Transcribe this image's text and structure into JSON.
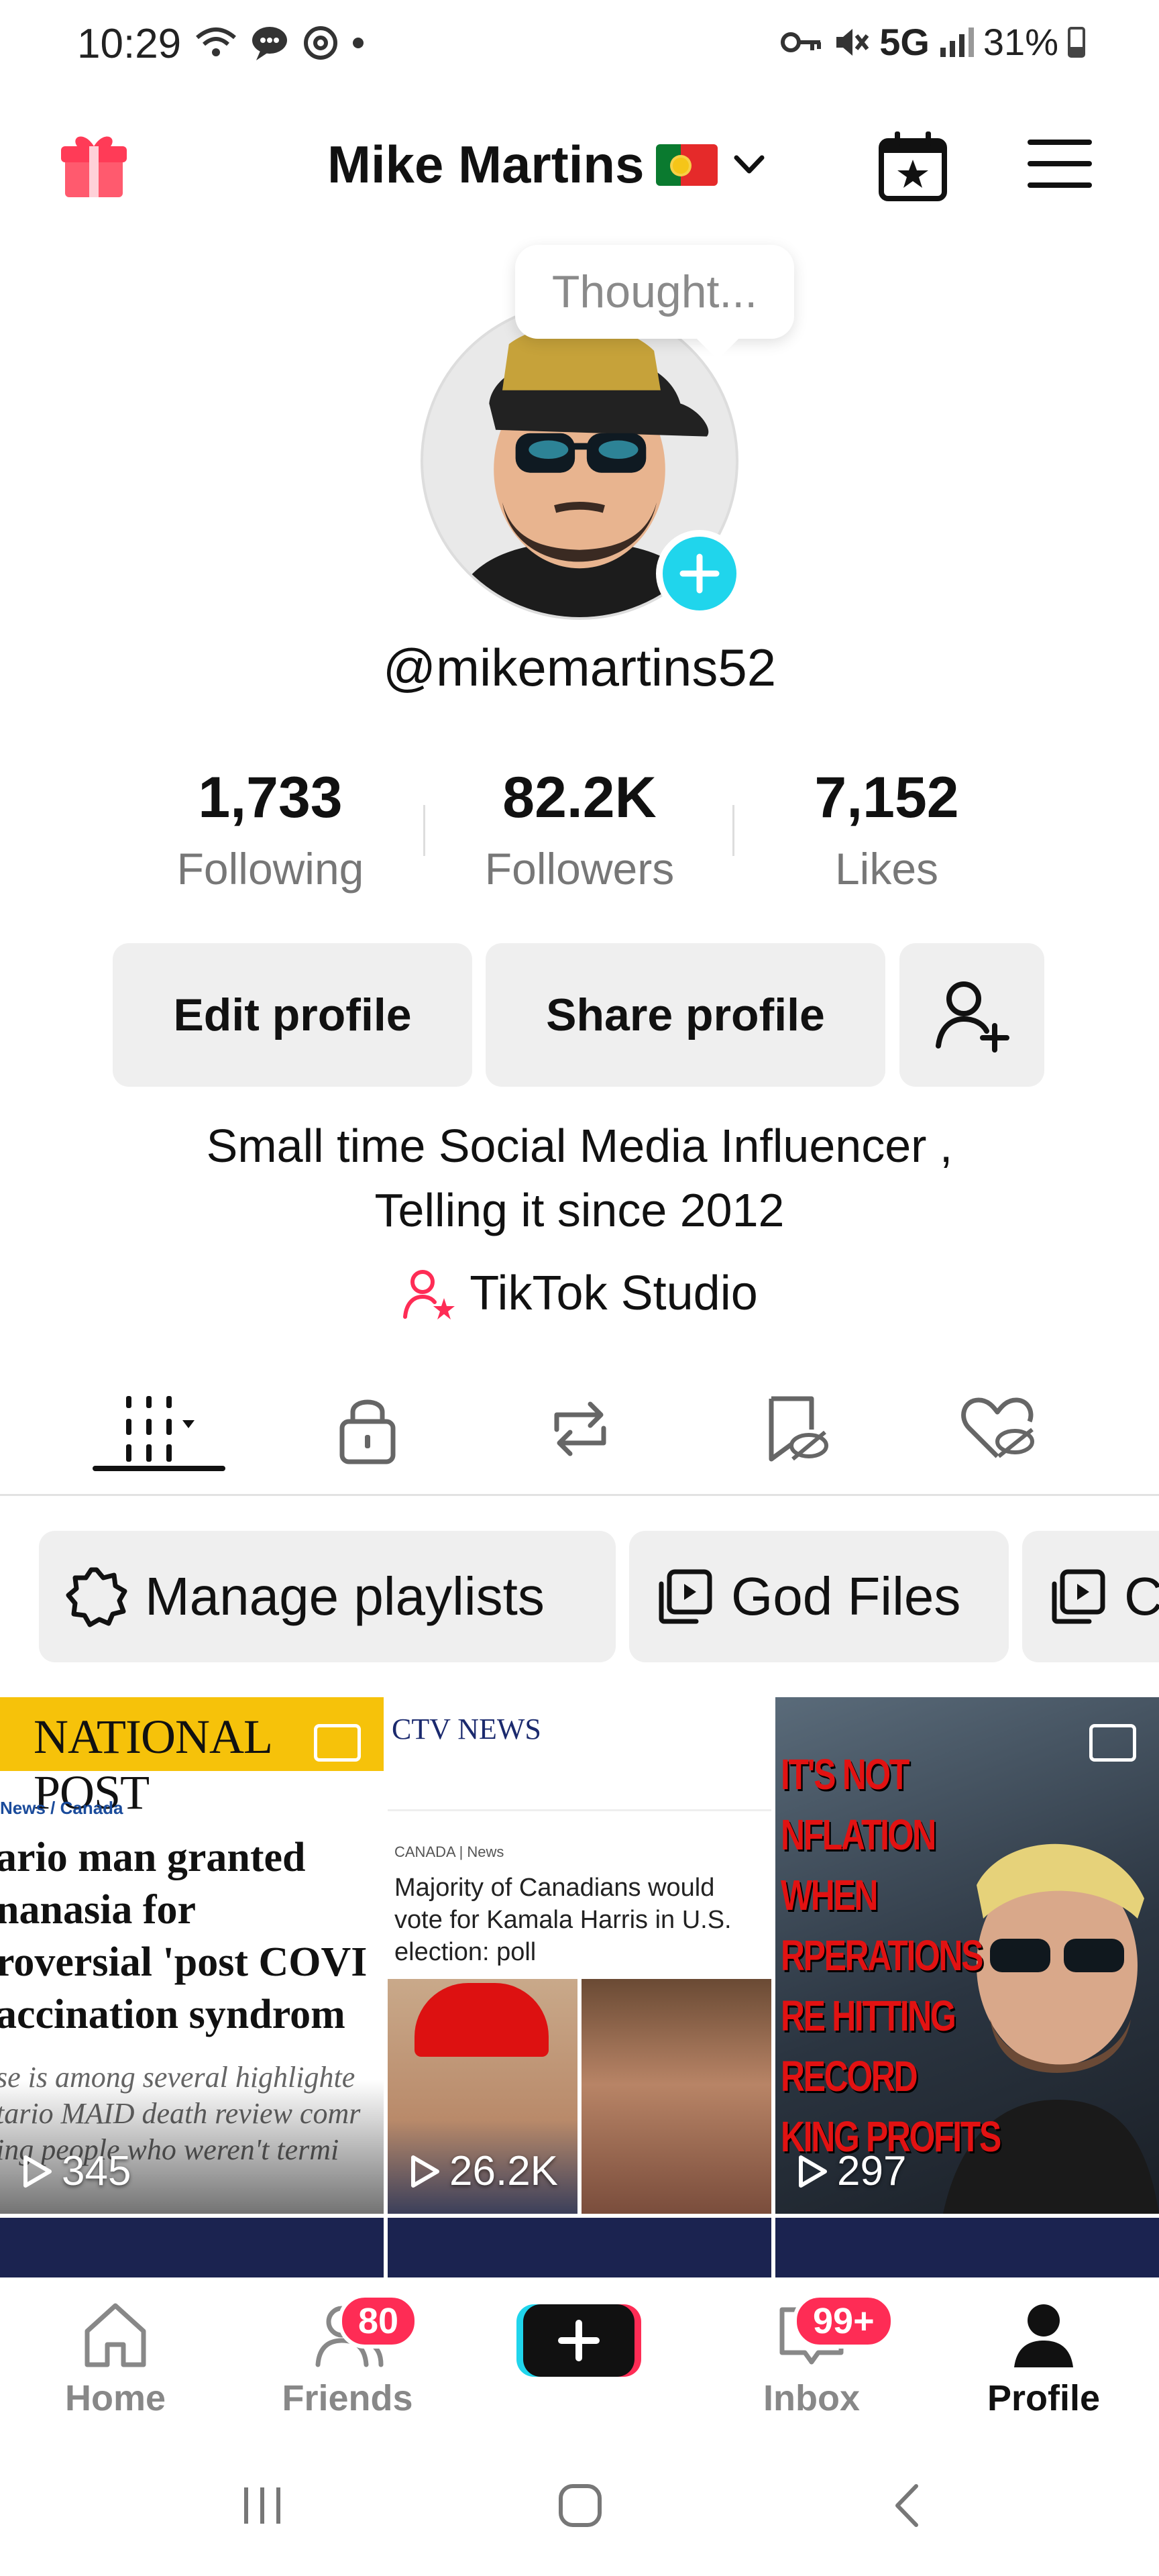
{
  "status_bar": {
    "time": "10:29",
    "network": "5G",
    "battery": "31%"
  },
  "header": {
    "name": "Mike Martins",
    "flag": "portugal-flag"
  },
  "avatar": {
    "thought": "Thought..."
  },
  "profile": {
    "handle": "@mikemartins52",
    "stats": [
      {
        "value": "1,733",
        "label": "Following"
      },
      {
        "value": "82.2K",
        "label": "Followers"
      },
      {
        "value": "7,152",
        "label": "Likes"
      }
    ],
    "edit_label": "Edit profile",
    "share_label": "Share profile",
    "bio_line1": "Small time Social Media Influencer ,",
    "bio_line2": "Telling it since 2012",
    "studio_label": "TikTok Studio"
  },
  "playlists": {
    "manage_label": "Manage playlists",
    "items": [
      "God Files",
      "C"
    ]
  },
  "videos": [
    {
      "views": "345",
      "source": "NATIONAL POST",
      "crumb": "News  /  Canada",
      "headline": "ario man granted\nnanasia for\nroversial 'post COVI\naccination syndrom",
      "sub": "se is among several highlighte\ntario MAID death review comr\ning people who weren't termi"
    },
    {
      "views": "26.2K",
      "source": "CTV NEWS",
      "crumb": "CANADA | News",
      "headline": "Majority of Canadians would vote for Kamala Harris in U.S. election: poll"
    },
    {
      "views": "297",
      "meme_text": "IT'S NOT\nNFLATION\nWHEN\nRPERATIONS\nRE HITTING\nRECORD\nKING PROFITS"
    }
  ],
  "bottom_nav": {
    "home": "Home",
    "friends": "Friends",
    "friends_badge": "80",
    "inbox": "Inbox",
    "inbox_badge": "99+",
    "profile": "Profile"
  },
  "colors": {
    "accent_cyan": "#20d5ec",
    "badge_red": "#fe2c55",
    "np_yellow": "#f6c20a"
  }
}
